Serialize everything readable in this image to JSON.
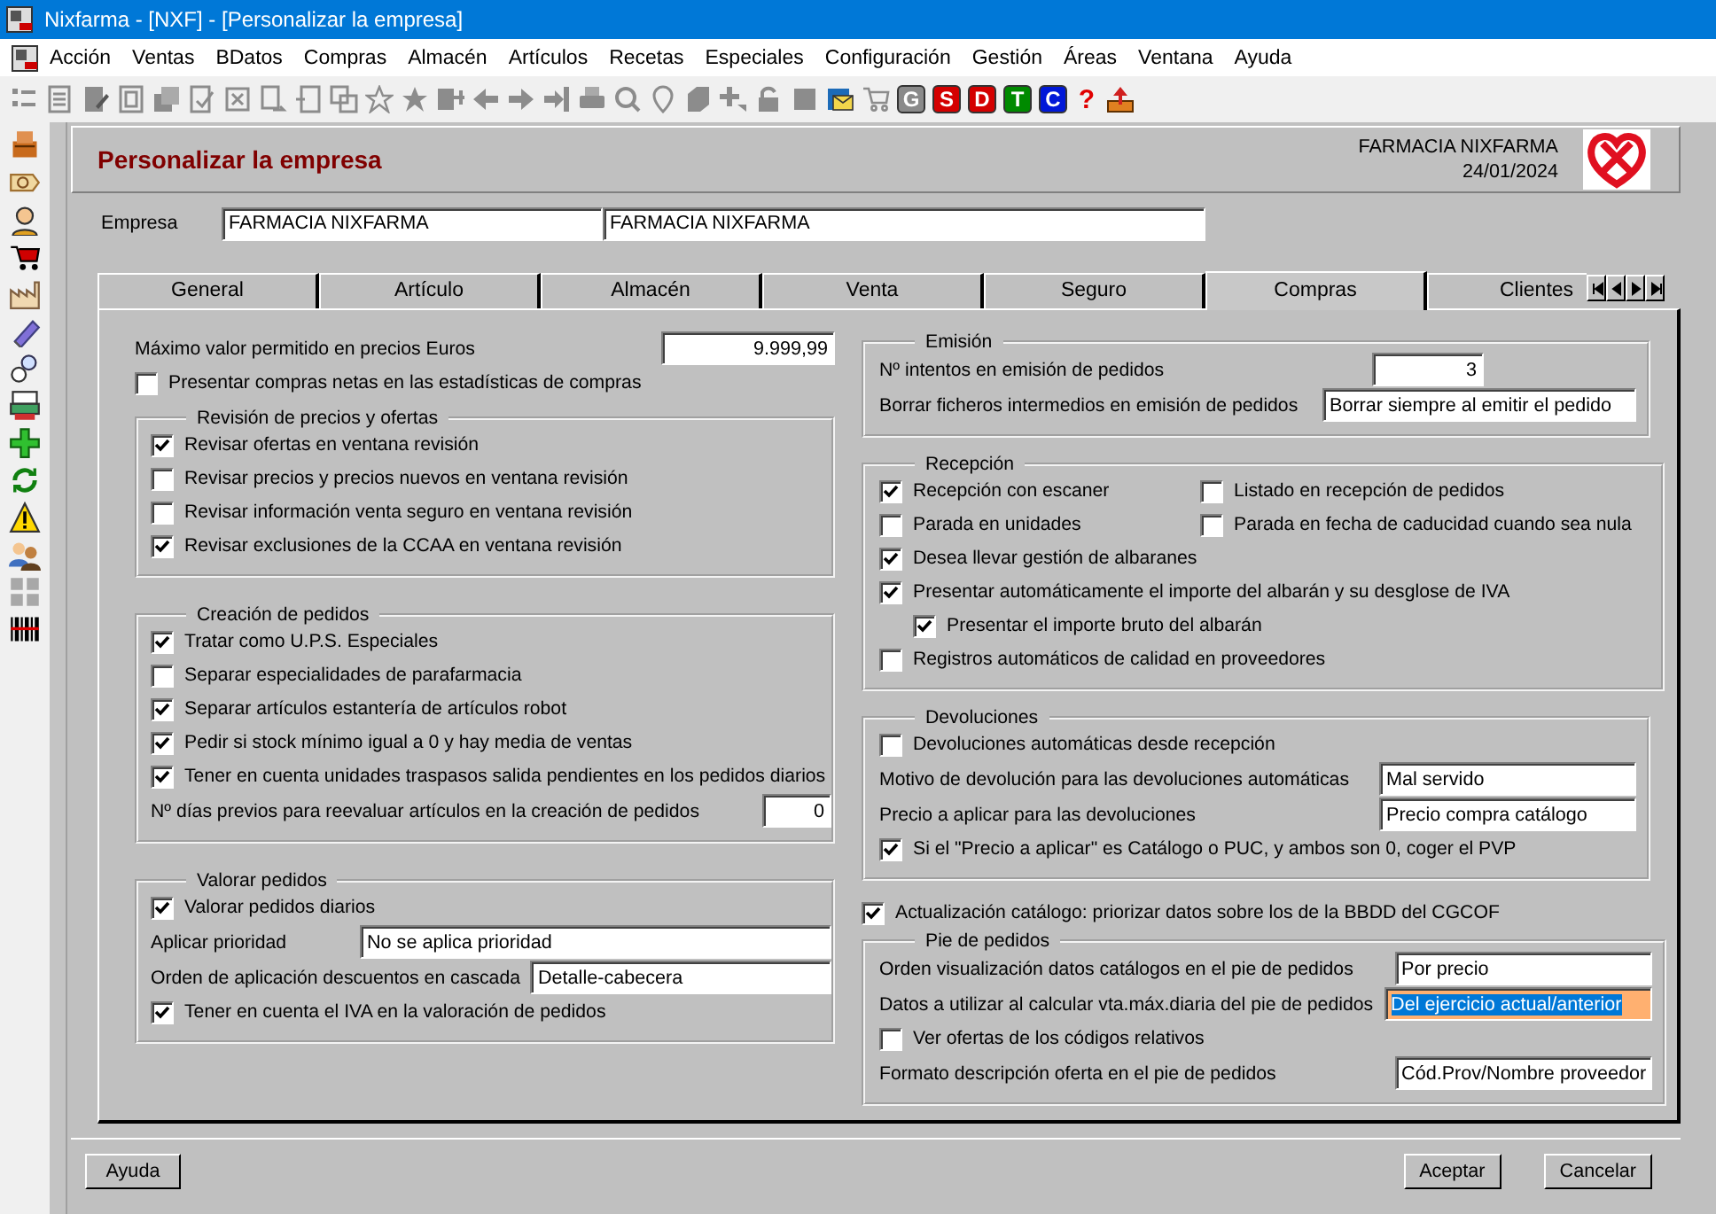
{
  "window": {
    "title": "Nixfarma - [NXF] - [Personalizar la empresa]"
  },
  "menu": [
    "Acción",
    "Ventas",
    "BDatos",
    "Compras",
    "Almacén",
    "Artículos",
    "Recetas",
    "Especiales",
    "Configuración",
    "Gestión",
    "Áreas",
    "Ventana",
    "Ayuda"
  ],
  "toolbar": {
    "letter_buttons": [
      {
        "label": "G",
        "color": "#8a8a8a"
      },
      {
        "label": "S",
        "color": "#d40000"
      },
      {
        "label": "D",
        "color": "#d40000"
      },
      {
        "label": "T",
        "color": "#008a00"
      },
      {
        "label": "C",
        "color": "#0018d8"
      }
    ],
    "help": "?"
  },
  "form": {
    "title": "Personalizar la empresa",
    "company": "FARMACIA NIXFARMA",
    "date": "24/01/2024"
  },
  "empresa": {
    "label": "Empresa",
    "values": [
      "FARMACIA NIXFARMA",
      "FARMACIA NIXFARMA"
    ]
  },
  "tabs": [
    {
      "label": "General",
      "selected": false
    },
    {
      "label": "Artículo",
      "selected": false
    },
    {
      "label": "Almacén",
      "selected": false
    },
    {
      "label": "Venta",
      "selected": false
    },
    {
      "label": "Seguro",
      "selected": false
    },
    {
      "label": "Compras",
      "selected": true
    },
    {
      "label": "Clientes",
      "selected": false
    }
  ],
  "left": [
    {
      "kind": "number_field",
      "label": "Máximo valor permitido en precios Euros",
      "value": "9.999,99",
      "selected": false
    },
    {
      "kind": "checkbox",
      "label": "Presentar compras netas en las estadísticas de compras",
      "checked": false
    },
    {
      "kind": "group",
      "title": "Revisión de precios y ofertas",
      "items": [
        {
          "kind": "checkbox",
          "label": "Revisar ofertas en ventana revisión",
          "checked": true
        },
        {
          "kind": "checkbox",
          "label": "Revisar precios y precios nuevos en ventana revisión",
          "checked": false
        },
        {
          "kind": "checkbox",
          "label": "Revisar información venta seguro en ventana revisión",
          "checked": false
        },
        {
          "kind": "checkbox",
          "label": "Revisar exclusiones de la CCAA en ventana revisión",
          "checked": true
        }
      ]
    },
    {
      "kind": "group",
      "title": "Creación de pedidos",
      "items": [
        {
          "kind": "checkbox",
          "label": "Tratar como U.P.S. Especiales",
          "checked": true
        },
        {
          "kind": "checkbox",
          "label": "Separar especialidades de parafarmacia",
          "checked": false
        },
        {
          "kind": "checkbox",
          "label": "Separar artículos estantería de artículos robot",
          "checked": true
        },
        {
          "kind": "checkbox",
          "label": "Pedir si stock mínimo igual a 0 y hay media de ventas",
          "checked": true
        },
        {
          "kind": "checkbox",
          "label": "Tener en cuenta unidades traspasos salida pendientes en los pedidos diarios",
          "checked": true
        },
        {
          "kind": "number_field",
          "label": "Nº días previos para reevaluar artículos en la creación de pedidos",
          "value": "0",
          "selected": false
        }
      ]
    },
    {
      "kind": "group",
      "title": "Valorar pedidos",
      "items": [
        {
          "kind": "checkbox",
          "label": "Valorar pedidos diarios",
          "checked": true
        },
        {
          "kind": "text_field",
          "label": "Aplicar prioridad",
          "value": "No se aplica prioridad",
          "selected": false
        },
        {
          "kind": "text_field",
          "label": "Orden de aplicación descuentos en cascada",
          "value": "Detalle-cabecera",
          "selected": false
        },
        {
          "kind": "checkbox",
          "label": "Tener en cuenta el IVA en la valoración de pedidos",
          "checked": true
        }
      ]
    }
  ],
  "right": [
    {
      "kind": "group",
      "title": "Emisión",
      "items": [
        {
          "kind": "number_field",
          "label": "Nº intentos en emisión de pedidos",
          "value": "3",
          "selected": false
        },
        {
          "kind": "text_field",
          "label": "Borrar ficheros intermedios en emisión de pedidos",
          "value": "Borrar siempre al emitir el pedido",
          "selected": false
        }
      ]
    },
    {
      "kind": "group",
      "title": "Recepción",
      "items": [
        {
          "kind": "checkbox_pair",
          "items": [
            {
              "kind": "checkbox",
              "label": "Recepción con escaner",
              "checked": true
            },
            {
              "kind": "checkbox",
              "label": "Listado en recepción de pedidos",
              "checked": false
            }
          ]
        },
        {
          "kind": "checkbox_pair",
          "items": [
            {
              "kind": "checkbox",
              "label": "Parada en unidades",
              "checked": false
            },
            {
              "kind": "checkbox",
              "label": "Parada en fecha de caducidad cuando sea nula",
              "checked": false
            }
          ]
        },
        {
          "kind": "checkbox",
          "label": "Desea llevar gestión de albaranes",
          "checked": true
        },
        {
          "kind": "checkbox",
          "label": "Presentar automáticamente el importe del albarán y su desglose de IVA",
          "checked": true,
          "children": [
            {
              "kind": "checkbox",
              "label": "Presentar el importe bruto del albarán",
              "checked": true
            }
          ]
        },
        {
          "kind": "checkbox",
          "label": "Registros automáticos de calidad en proveedores",
          "checked": false
        }
      ]
    },
    {
      "kind": "group",
      "title": "Devoluciones",
      "items": [
        {
          "kind": "checkbox",
          "label": "Devoluciones automáticas desde recepción",
          "checked": false
        },
        {
          "kind": "text_field",
          "label": "Motivo de devolución para las devoluciones automáticas",
          "value": "Mal servido",
          "selected": false
        },
        {
          "kind": "text_field",
          "label": "Precio a aplicar para las devoluciones",
          "value": "Precio compra catálogo",
          "selected": false
        },
        {
          "kind": "checkbox",
          "label": "Si el \"Precio a aplicar\" es Catálogo o PUC, y ambos son 0, coger el PVP",
          "checked": true
        }
      ]
    },
    {
      "kind": "checkbox",
      "label": "Actualización catálogo: priorizar datos sobre los de la BBDD del CGCOF",
      "checked": true
    },
    {
      "kind": "group",
      "title": "Pie de pedidos",
      "items": [
        {
          "kind": "text_field",
          "label": "Orden visualización datos catálogos en el pie de pedidos",
          "value": "Por precio",
          "selected": false
        },
        {
          "kind": "text_field",
          "label": "Datos a utilizar al calcular vta.máx.diaria del pie de pedidos",
          "value": "Del ejercicio actual/anterior",
          "selected": true
        },
        {
          "kind": "checkbox",
          "label": "Ver ofertas de los códigos relativos",
          "checked": false
        },
        {
          "kind": "text_field",
          "label": "Formato descripción oferta en el pie de pedidos",
          "value": "Cód.Prov/Nombre proveedor",
          "selected": false
        }
      ]
    }
  ],
  "buttons": [
    {
      "kind": "left",
      "label": "Ayuda"
    },
    {
      "kind": "right",
      "label": "Aceptar"
    },
    {
      "kind": "right",
      "label": "Cancelar"
    }
  ]
}
